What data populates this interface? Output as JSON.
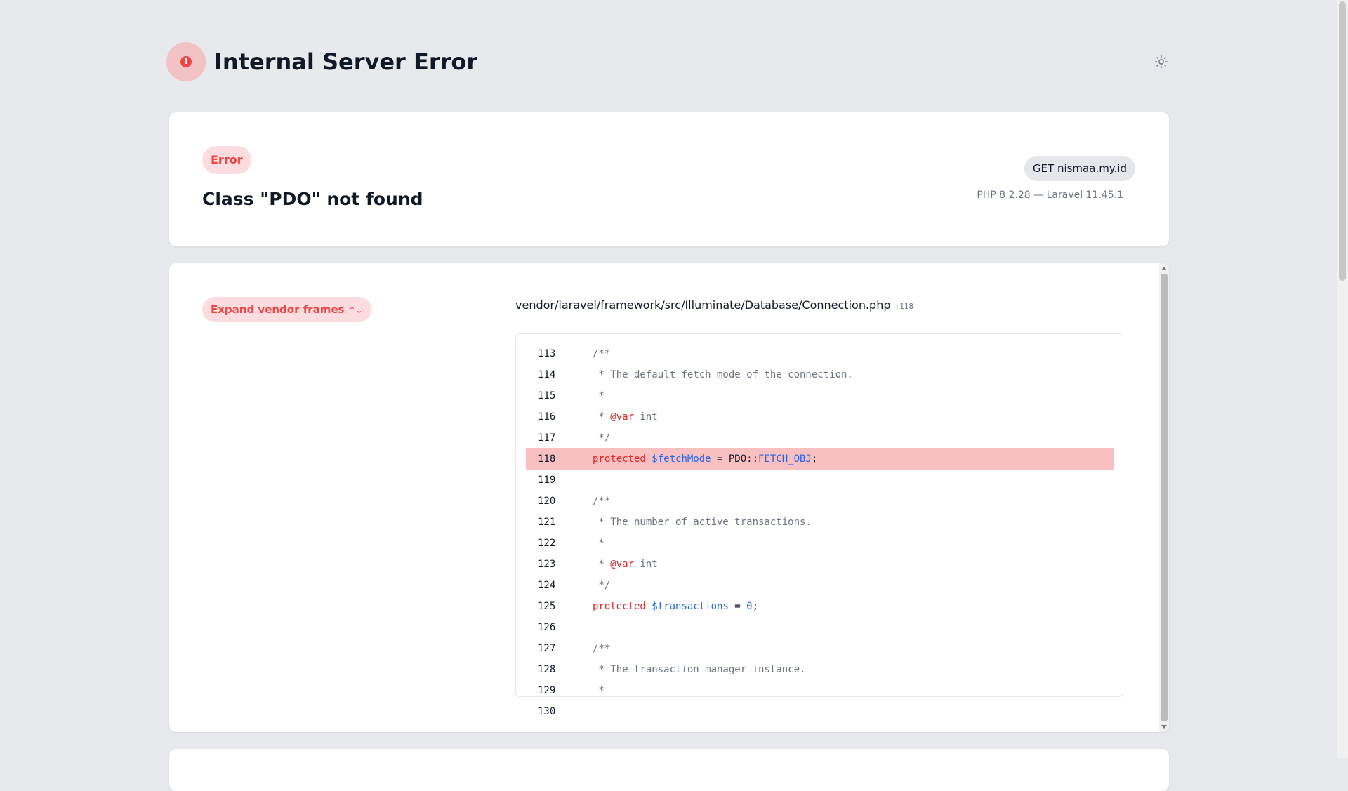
{
  "header": {
    "title": "Internal Server Error",
    "error_icon": "exclamation-circle-icon",
    "error_icon_glyph": "!",
    "theme_icon": "sun-icon"
  },
  "exception": {
    "badge": "Error",
    "message": "Class \"PDO\" not found",
    "request": "GET nismaa.my.id",
    "versions": "PHP 8.2.28 — Laravel 11.45.1"
  },
  "frames": {
    "expand_label": "Expand vendor frames",
    "expand_icon": "chevron-up-down-icon",
    "file": "vendor/laravel/framework/src/Illuminate/Database/Connection.php",
    "line": ":118"
  },
  "code": {
    "highlight_line": "118",
    "lines": [
      {
        "n": "113",
        "text": "/**"
      },
      {
        "n": "114",
        "text": " * The default fetch mode of the connection."
      },
      {
        "n": "115",
        "text": " *"
      },
      {
        "n": "116",
        "text": " * @var int"
      },
      {
        "n": "117",
        "text": " */"
      },
      {
        "n": "118",
        "text": "protected $fetchMode = PDO::FETCH_OBJ;"
      },
      {
        "n": "119",
        "text": ""
      },
      {
        "n": "120",
        "text": "/**"
      },
      {
        "n": "121",
        "text": " * The number of active transactions."
      },
      {
        "n": "122",
        "text": " *"
      },
      {
        "n": "123",
        "text": " * @var int"
      },
      {
        "n": "124",
        "text": " */"
      },
      {
        "n": "125",
        "text": "protected $transactions = 0;"
      },
      {
        "n": "126",
        "text": ""
      },
      {
        "n": "127",
        "text": "/**"
      },
      {
        "n": "128",
        "text": " * The transaction manager instance."
      },
      {
        "n": "129",
        "text": " *"
      },
      {
        "n": "130",
        "text": ""
      }
    ]
  },
  "colors": {
    "error_red": "#ef4444",
    "highlight_bg": "#f9c0c2",
    "keyword": "#dc2626",
    "variable": "#2563eb"
  }
}
